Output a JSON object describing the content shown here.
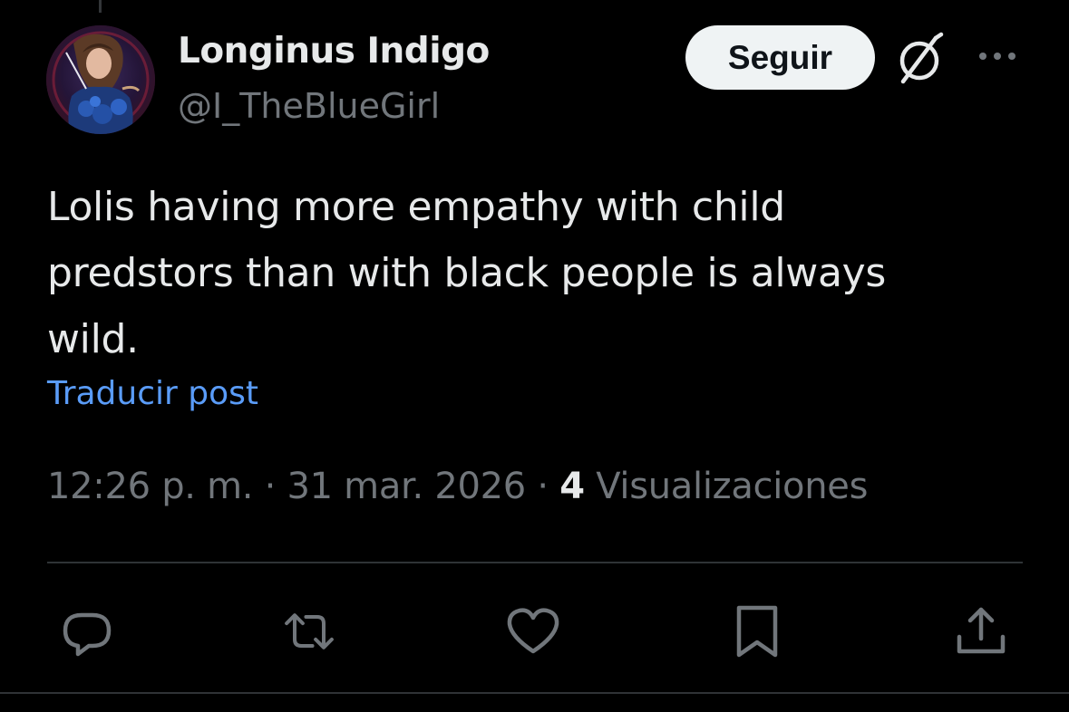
{
  "author": {
    "display_name": "Longinus Indigo",
    "handle": "@I_TheBlueGirl"
  },
  "header": {
    "follow_label": "Seguir",
    "grok_icon": "grok-slash-icon",
    "more_icon": "more-horizontal-icon"
  },
  "post": {
    "text": "Lolis having more empathy with child\npredstors than with black people is always\nwild.",
    "translate_label": "Traducir post"
  },
  "meta": {
    "time": "12:26 p. m.",
    "separator": "·",
    "date": "31 mar. 2026",
    "views_count": "4",
    "views_label": "Visualizaciones"
  },
  "actions": [
    {
      "name": "reply",
      "icon": "reply-icon"
    },
    {
      "name": "repost",
      "icon": "repost-icon"
    },
    {
      "name": "like",
      "icon": "heart-icon"
    },
    {
      "name": "bookmark",
      "icon": "bookmark-icon"
    },
    {
      "name": "share",
      "icon": "share-icon"
    }
  ],
  "colors": {
    "background": "#000000",
    "primary_text": "#e7e9ea",
    "secondary_text": "#71767b",
    "link": "#5a9cf8",
    "follow_bg": "#eff3f4",
    "divider": "#2f3336"
  }
}
